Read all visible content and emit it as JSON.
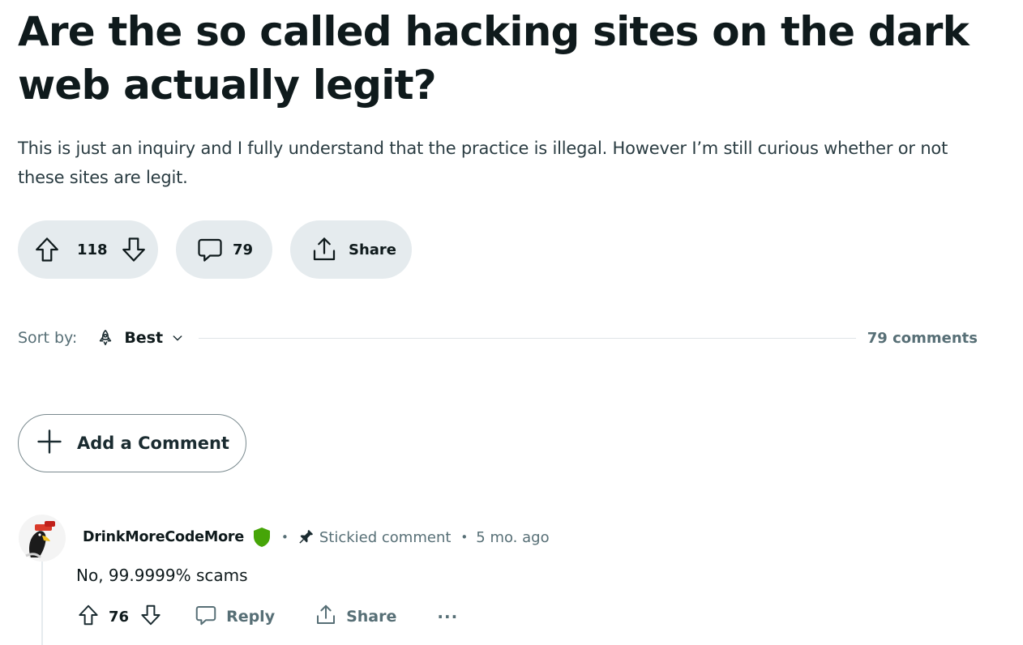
{
  "post": {
    "title": "Are the so called hacking sites on the dark web actually legit?",
    "body": "This is just an inquiry and I fully understand that the practice is illegal. However I’m still curious whether or not these sites are legit.",
    "vote_count": "118",
    "comment_count": "79",
    "share_label": "Share"
  },
  "sort": {
    "label": "Sort by:",
    "value": "Best",
    "icon": "rocket-icon",
    "comments_total": "79 comments"
  },
  "add_comment": {
    "label": "Add a Comment",
    "icon": "plus-icon"
  },
  "comments": [
    {
      "author": "DrinkMoreCodeMore",
      "moderator_badge_color": "#46a508",
      "stickied_label": "Stickied comment",
      "timestamp": "5 mo. ago",
      "text": "No, 99.9999% scams",
      "votes": "76",
      "reply_label": "Reply",
      "share_label": "Share",
      "more_label": "···"
    }
  ],
  "colors": {
    "pill_background": "#e5ebee",
    "muted_text": "#576f76",
    "title_text": "#0f1a1c"
  }
}
